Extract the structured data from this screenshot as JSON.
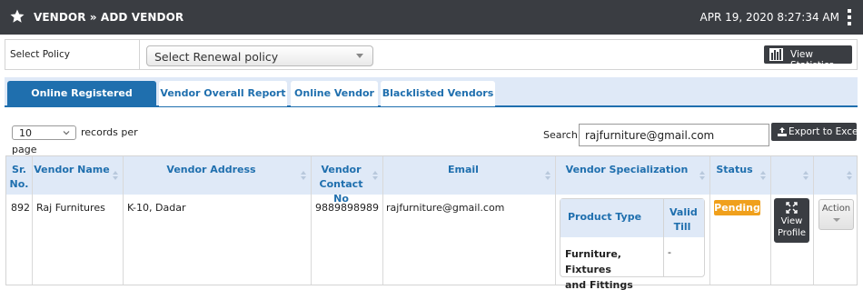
{
  "header": {
    "title": "VENDOR » ADD VENDOR",
    "datetime": "APR 19, 2020  8:27:34 AM",
    "star_icon": "star-icon",
    "menu_icon": "kebab-menu-icon"
  },
  "policy": {
    "label": "Select Policy",
    "select_value": "Select Renewal policy",
    "stats_button": "View Statistics"
  },
  "tabs": [
    {
      "label": "Online Registered Vendors",
      "active": true
    },
    {
      "label": "Vendor Overall Report",
      "active": false
    },
    {
      "label": "Online Vendor",
      "active": false
    },
    {
      "label": "Blacklisted Vendors",
      "active": false
    }
  ],
  "records": {
    "value": "10",
    "suffix": "records per",
    "suffix2": "page"
  },
  "search": {
    "label": "Search:",
    "value": "rajfurniture@gmail.com"
  },
  "export_button": "Export to Excel",
  "table": {
    "columns": [
      {
        "line1": "Sr.",
        "line2": "No."
      },
      {
        "line1": "Vendor Name",
        "line2": ""
      },
      {
        "line1": "Vendor Address",
        "line2": ""
      },
      {
        "line1": "Vendor",
        "line2": "Contact No"
      },
      {
        "line1": "Email",
        "line2": ""
      },
      {
        "line1": "Vendor Specialization",
        "line2": ""
      },
      {
        "line1": "Status",
        "line2": ""
      }
    ],
    "row": {
      "sr": "892",
      "name": "Raj Furnitures",
      "address": "K-10, Dadar",
      "contact": "9889898989",
      "email": "rajfurniture@gmail.com",
      "status": "Pending",
      "view_profile_1": "View",
      "view_profile_2": "Profile",
      "action": "Action"
    },
    "specialization": {
      "col1": "Product Type",
      "col2_line1": "Valid",
      "col2_line2": "Till",
      "product_line1": "Furniture, Fixtures",
      "product_line2": "and Fittings",
      "valid_till": "-"
    }
  },
  "colors": {
    "header_bg": "#3a3d42",
    "accent_blue": "#1f6fae",
    "table_header_bg": "#dfe9f7",
    "pending": "#f0a01c"
  }
}
